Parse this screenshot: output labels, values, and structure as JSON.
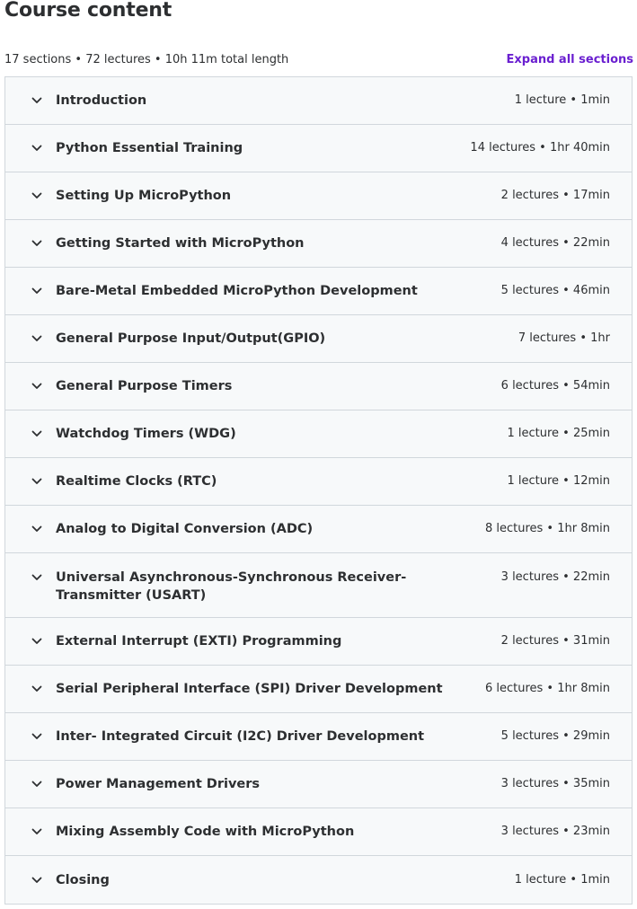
{
  "header": {
    "title": "Course content",
    "summary": "17 sections • 72 lectures • 10h 11m total length",
    "expand_label": "Expand all sections"
  },
  "icons": {
    "section_toggle": "chevron-down-icon"
  },
  "colors": {
    "accent": "#6a1fd0",
    "section_bg": "#f7f9fa",
    "border": "#d1d7dc",
    "text": "#2d2f31"
  },
  "sections": [
    {
      "title": "Introduction",
      "meta": "1 lecture • 1min"
    },
    {
      "title": "Python Essential Training",
      "meta": "14 lectures • 1hr 40min"
    },
    {
      "title": "Setting Up MicroPython",
      "meta": "2 lectures • 17min"
    },
    {
      "title": "Getting Started with MicroPython",
      "meta": "4 lectures • 22min"
    },
    {
      "title": "Bare-Metal Embedded MicroPython Development",
      "meta": "5 lectures • 46min"
    },
    {
      "title": "General Purpose Input/Output(GPIO)",
      "meta": "7 lectures • 1hr"
    },
    {
      "title": "General Purpose Timers",
      "meta": "6 lectures • 54min"
    },
    {
      "title": "Watchdog Timers (WDG)",
      "meta": "1 lecture • 25min"
    },
    {
      "title": "Realtime Clocks (RTC)",
      "meta": "1 lecture • 12min"
    },
    {
      "title": "Analog to Digital Conversion (ADC)",
      "meta": "8 lectures • 1hr 8min"
    },
    {
      "title": "Universal Asynchronous-Synchronous Receiver-Transmitter (USART)",
      "meta": "3 lectures • 22min"
    },
    {
      "title": "External Interrupt (EXTI) Programming",
      "meta": "2 lectures • 31min"
    },
    {
      "title": "Serial Peripheral Interface (SPI) Driver Development",
      "meta": "6 lectures • 1hr 8min"
    },
    {
      "title": "Inter- Integrated Circuit (I2C) Driver Development",
      "meta": "5 lectures • 29min"
    },
    {
      "title": "Power Management Drivers",
      "meta": "3 lectures • 35min"
    },
    {
      "title": "Mixing Assembly Code with MicroPython",
      "meta": "3 lectures • 23min"
    },
    {
      "title": "Closing",
      "meta": "1 lecture • 1min"
    }
  ]
}
